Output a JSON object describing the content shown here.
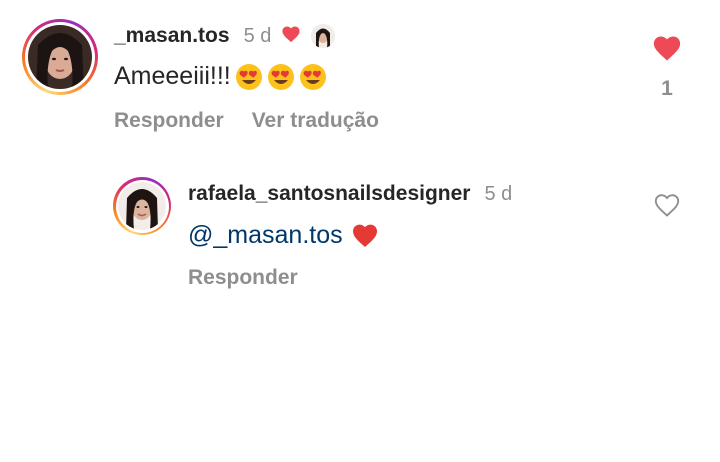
{
  "comments": [
    {
      "username": "_masan.tos",
      "time": "5 d",
      "text": "Ameeeiii!!!",
      "emoji_count": 3,
      "emoji": "heart-eyes-emoji",
      "liked_by_author": true,
      "likes": "1",
      "liked": true,
      "actions": {
        "reply": "Responder",
        "translate": "Ver tradução"
      }
    },
    {
      "username": "rafaela_santosnailsdesigner",
      "time": "5 d",
      "mention": "@_masan.tos",
      "trailing_emoji": "red-heart-emoji",
      "liked": false,
      "actions": {
        "reply": "Responder"
      }
    }
  ],
  "colors": {
    "like_active": "#ed4956",
    "secondary_text": "#8e8e8e",
    "mention": "#00376b",
    "primary_text": "#262626"
  }
}
